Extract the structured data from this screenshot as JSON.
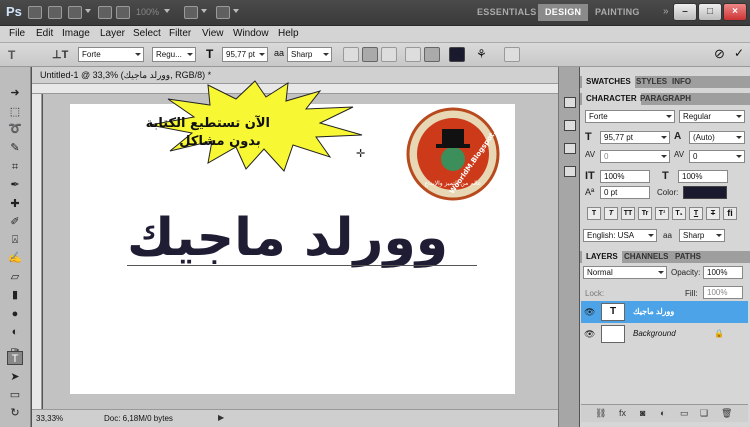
{
  "app": {
    "logo": "Ps",
    "zoom": "100%"
  },
  "workspaces": {
    "essentials": "ESSENTIALS",
    "design": "DESIGN",
    "painting": "PAINTING",
    "more": "»"
  },
  "menu": [
    "File",
    "Edit",
    "Image",
    "Layer",
    "Select",
    "Filter",
    "View",
    "Window",
    "Help"
  ],
  "options": {
    "font_family": "Forte",
    "font_style": "Regu...",
    "font_size": "95,77 pt",
    "aa_label": "aa",
    "antialias": "Sharp",
    "text_color": "#1a1a2e"
  },
  "document": {
    "tab_title": "Untitled-1 @ 33,3% (وورلد ماجيك, RGB/8) *",
    "close": "×",
    "zoom": "33,33%",
    "doc_size": "Doc: 6,18M/0 bytes",
    "canvas_text": "وورلد ماجيك",
    "starburst_line1": "الآن تستطيع الكتابة",
    "starburst_line2": "بدون مشاكل",
    "logo_text": "WoorldM.Blogspot.com",
    "logo_subtext": "عالم من التميز والإبداع"
  },
  "panels": {
    "top_tabs": [
      "SWATCHES",
      "STYLES",
      "INFO"
    ],
    "char_tabs": [
      "CHARACTER",
      "PARAGRAPH"
    ],
    "character": {
      "font_family": "Forte",
      "font_style": "Regular",
      "size": "95,77 pt",
      "leading": "(Auto)",
      "kerning": "0",
      "tracking": "0",
      "vscale": "100%",
      "hscale": "100%",
      "baseline": "0 pt",
      "color_label": "Color:",
      "color": "#1a1a2e",
      "style_buttons": [
        "T",
        "T",
        "TT",
        "Tr",
        "T¹",
        "T₁",
        "T",
        "T"
      ],
      "language": "English: USA",
      "aa_label": "aa",
      "antialias": "Sharp"
    },
    "layer_tabs": [
      "LAYERS",
      "CHANNELS",
      "PATHS"
    ],
    "layers": {
      "blend_mode": "Normal",
      "opacity_label": "Opacity:",
      "opacity": "100%",
      "lock_label": "Lock:",
      "fill_label": "Fill:",
      "fill": "100%",
      "items": [
        {
          "name": "وورلد ماجيك",
          "thumb": "T",
          "selected": true
        },
        {
          "name": "Background",
          "thumb": "",
          "selected": false
        }
      ]
    }
  }
}
